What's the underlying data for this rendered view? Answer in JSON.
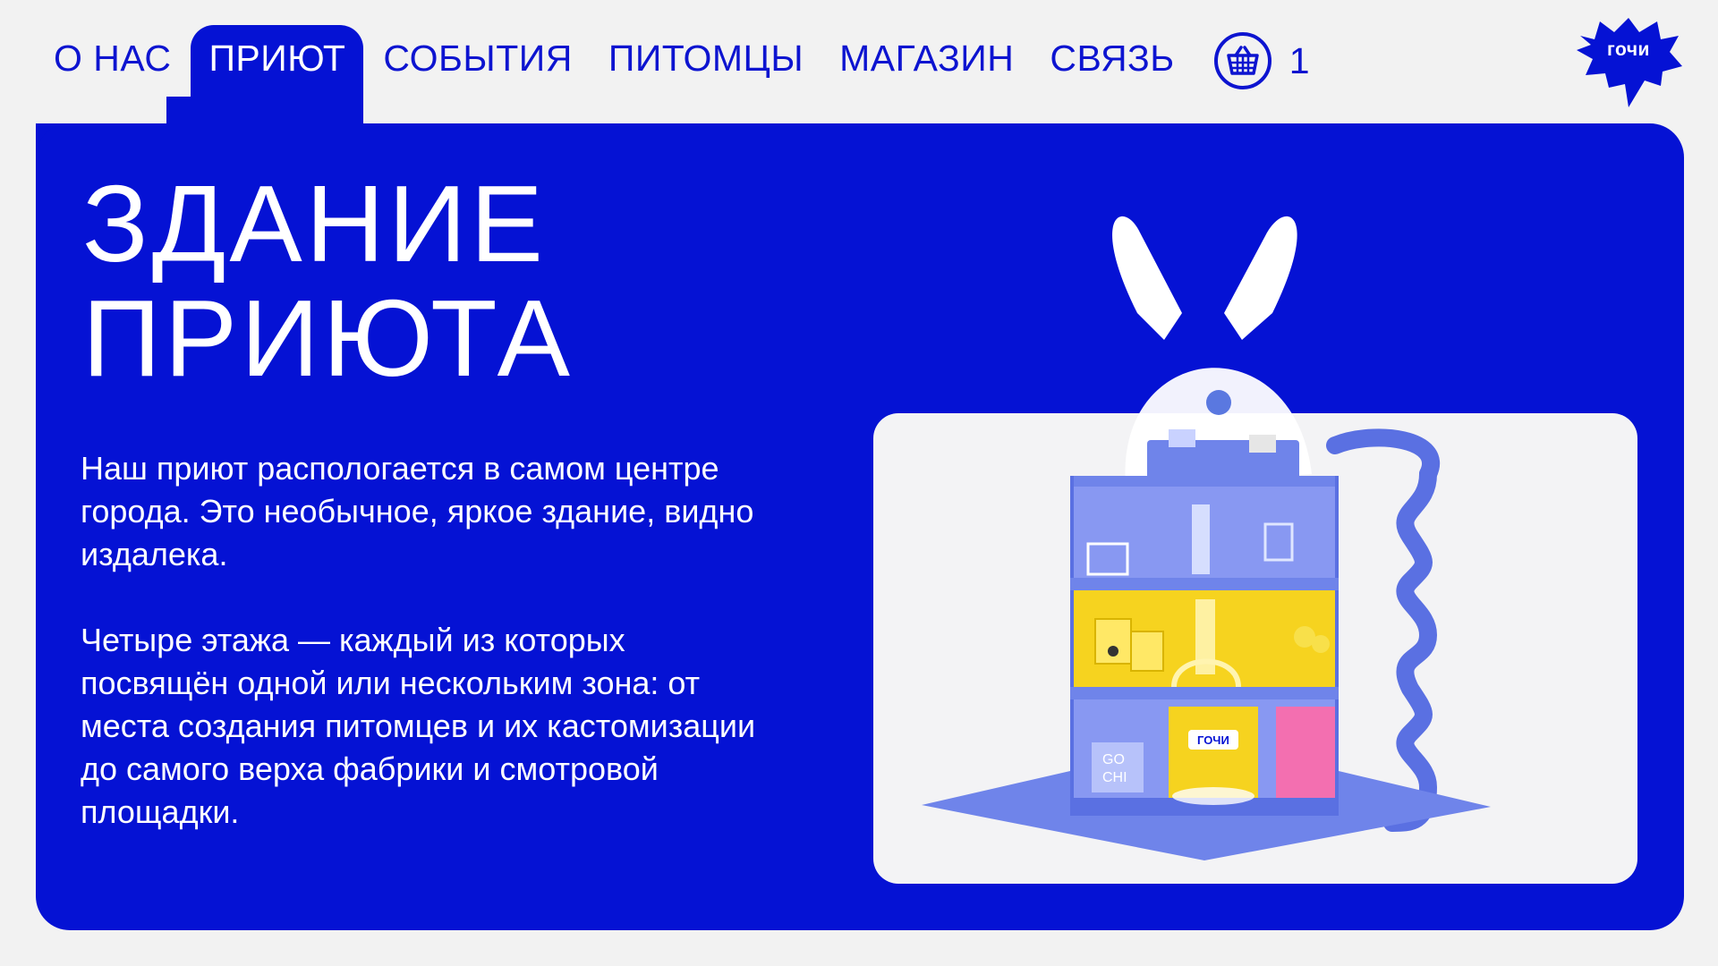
{
  "nav": {
    "items": [
      {
        "label": "О НАС",
        "active": false
      },
      {
        "label": "ПРИЮТ",
        "active": true
      },
      {
        "label": "СОБЫТИЯ",
        "active": false
      },
      {
        "label": "ПИТОМЦЫ",
        "active": false
      },
      {
        "label": "МАГАЗИН",
        "active": false
      },
      {
        "label": "СВЯЗЬ",
        "active": false
      }
    ],
    "cart_count": "1"
  },
  "logo": {
    "text": "гочи"
  },
  "main": {
    "title_line1": "ЗДАНИЕ",
    "title_line2": "ПРИЮТА",
    "paragraph1": "Наш приют распологается в самом центре города. Это необычное, яркое здание, видно издалека.",
    "paragraph2": "Четыре этажа — каждый из которых посвящён одной или нескольким зона: от места создания питомцев и их кастомизации до самого верха фабрики и смотровой площадки."
  },
  "illustration": {
    "sign_text": "ГОЧИ",
    "gochi_text_1": "GO",
    "gochi_text_2": "CHI"
  },
  "colors": {
    "primary": "#0512d4",
    "nav_text": "#0d14d0",
    "background": "#f2f2f2",
    "floor_blue": "#7b8cf0",
    "floor_yellow": "#f6d31f",
    "floor_pink": "#f36fb0"
  }
}
